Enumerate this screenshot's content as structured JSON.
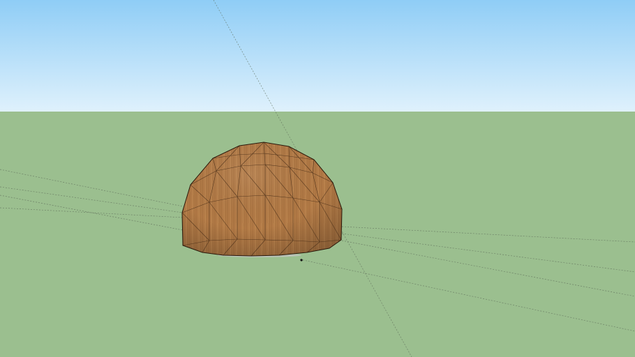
{
  "scene": {
    "model": "geodesic-dome",
    "material": "wood-grain",
    "colors": {
      "sky_top": "#8fcdf6",
      "sky_horizon": "#dff1fc",
      "ground": "#9bbf8f",
      "dome_light": "#b27a46",
      "dome_dark": "#8a5628",
      "dome_edge": "#3b2412",
      "guide_line": "#5f6e5a",
      "shadow": "#b9c3b6"
    }
  }
}
